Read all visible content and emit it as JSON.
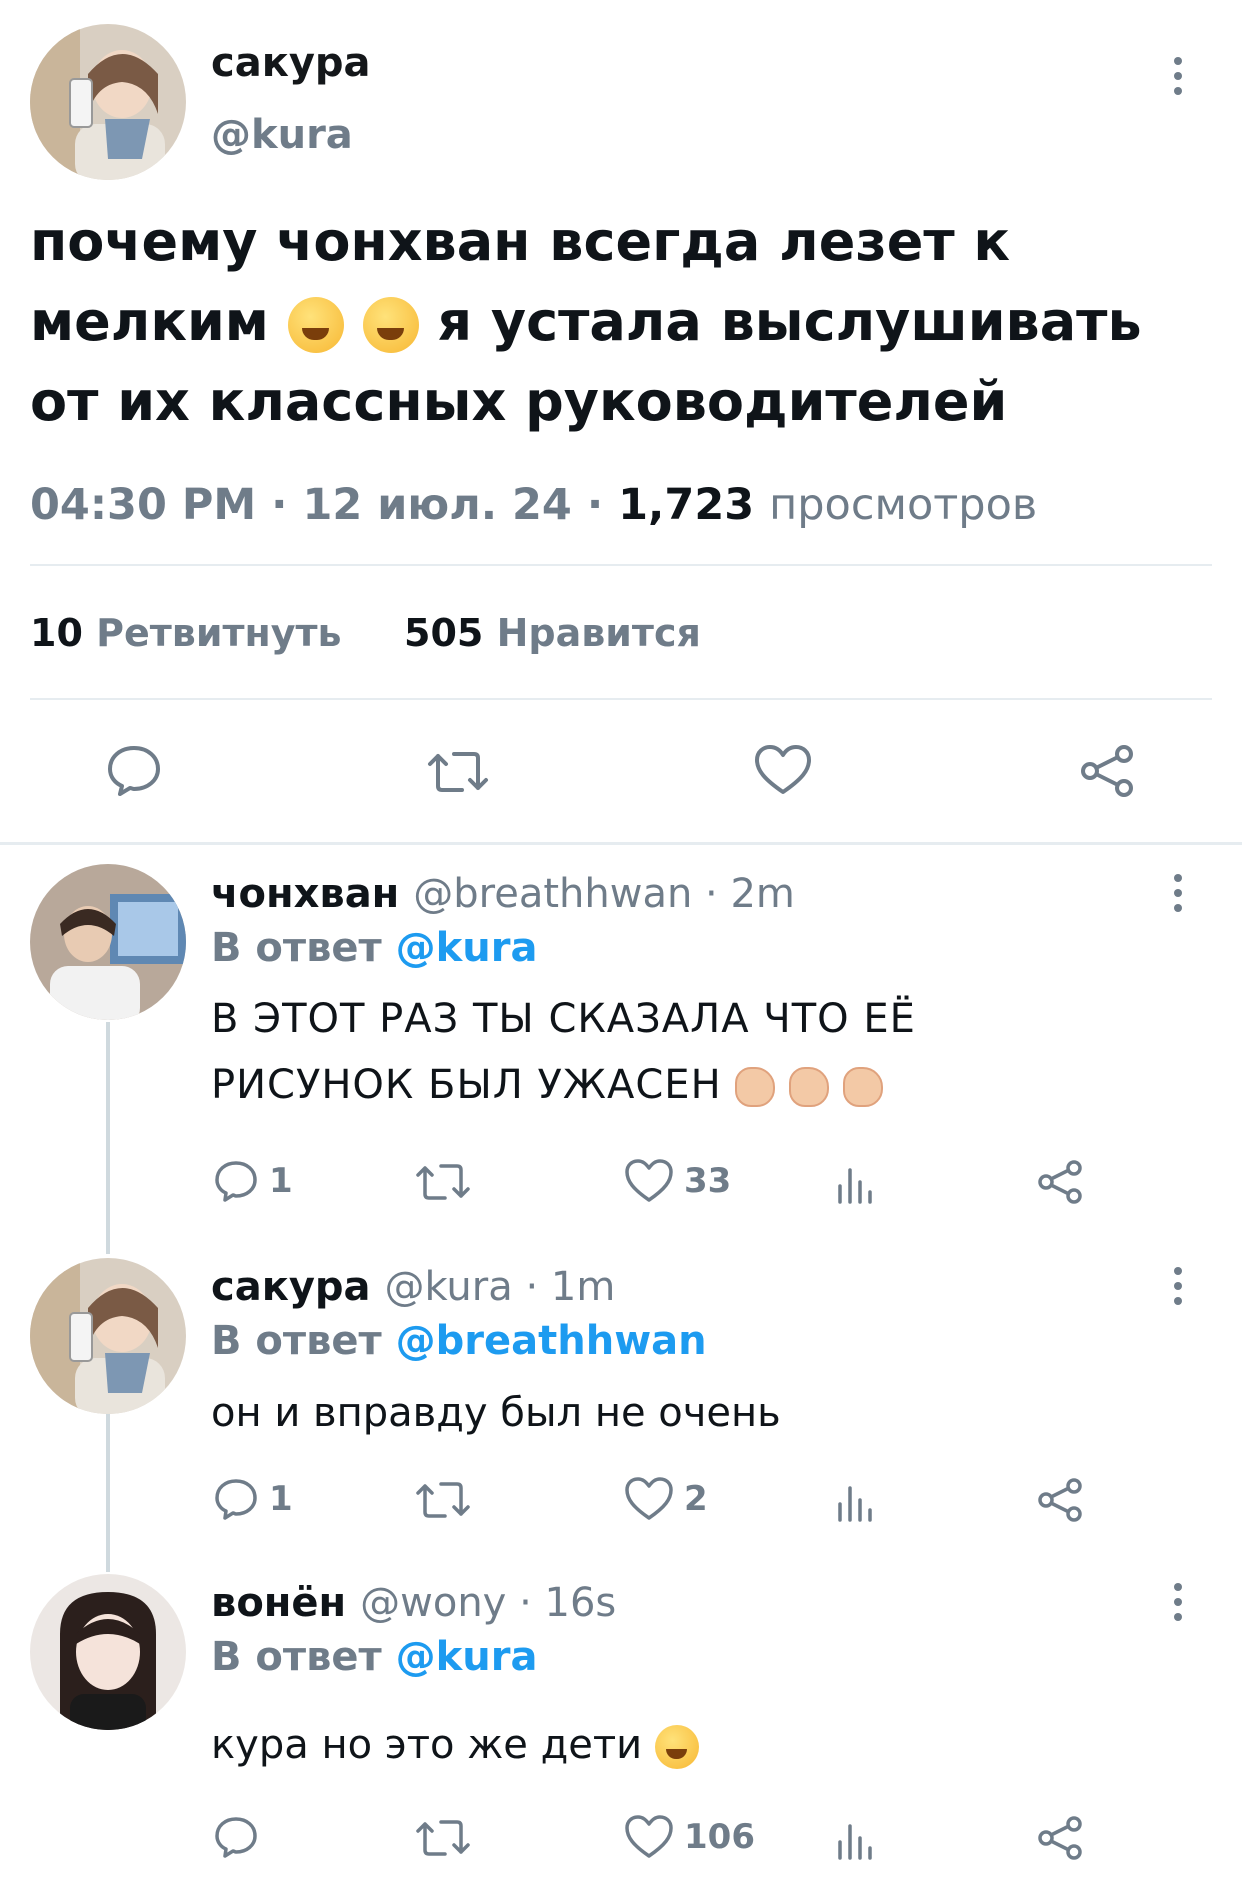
{
  "main_tweet": {
    "name": "сакура",
    "handle": "@kura",
    "text_line1": "почему чонхван всегда лезет к",
    "text_line2_a": "мелким",
    "text_line2_b": "я устала выслушивать",
    "text_line3": "от их классных руководителей",
    "time": "04:30 PM",
    "date": "12 июл. 24",
    "views": "1,723",
    "views_label": "просмотров",
    "retweets_count": "10",
    "retweets_label": "Ретвитнуть",
    "likes_count": "505",
    "likes_label": "Нравится"
  },
  "replies": [
    {
      "name": "чонхван",
      "handle": "@breathhwan · 2m",
      "reply_prefix": "В ответ",
      "reply_to": "@kura",
      "text_line1": "В ЭТОТ РАЗ ТЫ СКАЗАЛА ЧТО ЕЁ",
      "text_line2": "РИСУНОК БЫЛ УЖАСЕН",
      "comments": "1",
      "likes": "33"
    },
    {
      "name": "сакура",
      "handle": "@kura · 1m",
      "reply_prefix": "В ответ",
      "reply_to": "@breathhwan",
      "text_line1": "он и вправду был не очень",
      "comments": "1",
      "likes": "2"
    },
    {
      "name": "вонён",
      "handle": "@wony · 16s",
      "reply_prefix": "В ответ",
      "reply_to": "@kura",
      "text_line1": "кура но это же дети",
      "comments": "",
      "likes": "106"
    }
  ],
  "colors": {
    "accent": "#1d9bf0",
    "secondary_text": "#6f7c89",
    "divider": "#e6ecf0"
  },
  "icons": [
    "more-icon",
    "reply-icon",
    "retweet-icon",
    "like-icon",
    "share-icon",
    "stats-icon"
  ]
}
